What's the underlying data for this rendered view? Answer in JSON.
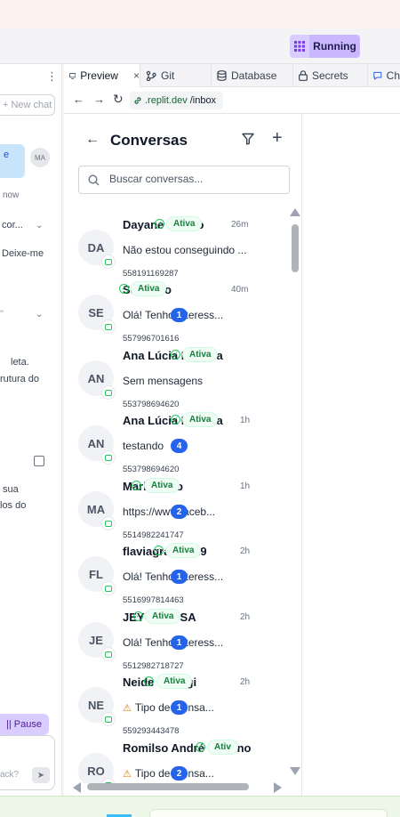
{
  "app": {
    "run_status": "Running"
  },
  "chat_panel": {
    "new_chat_label": "+ New chat",
    "avatar_initials": "MA",
    "bubble_text": "e",
    "timestamp": "now",
    "line_1": "cor...",
    "line_2": "Deixe-me",
    "line_3": "leta.",
    "line_4": "rutura do",
    "line_5": "sua",
    "line_6": "los do",
    "pause_label": "|| Pause",
    "input_placeholder": "ack?"
  },
  "tabs": [
    {
      "label": "Preview",
      "icon": "monitor-icon",
      "close": "×"
    },
    {
      "label": "Git",
      "icon": "git-icon"
    },
    {
      "label": "Database",
      "icon": "database-icon"
    },
    {
      "label": "Secrets",
      "icon": "lock-icon"
    },
    {
      "label": "Ch",
      "icon": "chat-icon"
    }
  ],
  "url": {
    "host": ".replit.dev",
    "path": "/inbox"
  },
  "inbox": {
    "title": "Conversas",
    "search_placeholder": "Buscar conversas...",
    "conversations": [
      {
        "initials": "DA",
        "name": "Dayane Teofilo",
        "status": "Ativa",
        "time": "26m",
        "preview": "Não estou conseguindo ...",
        "unread": "",
        "phone": "558191169287",
        "warning": false
      },
      {
        "initials": "SE",
        "name": "Severino",
        "status": "Ativa",
        "time": "40m",
        "preview": "Olá! Tenho interess...",
        "unread": "1",
        "phone": "557996701616",
        "warning": false
      },
      {
        "initials": "AN",
        "name": "Ana Lúcia Moreira",
        "status": "Ativa",
        "time": "",
        "preview": "Sem mensagens",
        "unread": "",
        "phone": "553798694620",
        "warning": false
      },
      {
        "initials": "AN",
        "name": "Ana Lúcia Moreira",
        "status": "Ativa",
        "time": "1h",
        "preview": "testando",
        "unread": "4",
        "phone": "553798694620",
        "warning": false
      },
      {
        "initials": "MA",
        "name": "Maria Brito",
        "status": "Ativa",
        "time": "1h",
        "preview": "https://www.faceb...",
        "unread": "2",
        "phone": "5514982241747",
        "warning": false
      },
      {
        "initials": "FL",
        "name": "flaviagranucci9",
        "status": "Ativa",
        "time": "2h",
        "preview": "Olá! Tenho interess...",
        "unread": "1",
        "phone": "5516997814463",
        "warning": false
      },
      {
        "initials": "JE",
        "name": "JEYCE ACSA",
        "status": "Ativa",
        "time": "2h",
        "preview": "Olá! Tenho interess...",
        "unread": "1",
        "phone": "5512982718727",
        "warning": false
      },
      {
        "initials": "NE",
        "name": "Neide Pirangi",
        "status": "Ativa",
        "time": "2h",
        "preview": "Tipo de mensa...",
        "unread": "1",
        "phone": "559293443478",
        "warning": true
      },
      {
        "initials": "RO",
        "name": "Romilso André Vitorino",
        "status": "Ativ",
        "time": "",
        "preview": "Tipo de mensa...",
        "unread": "2",
        "phone": "",
        "warning": true
      }
    ]
  },
  "colors": {
    "accent": "#2563eb",
    "active_green": "#15803d",
    "run_purple": "#c9b8ff"
  }
}
